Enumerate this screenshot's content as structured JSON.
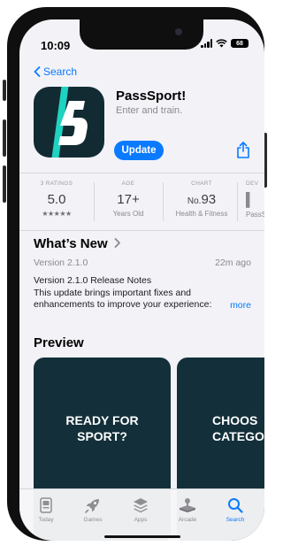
{
  "status_bar": {
    "time": "10:09",
    "battery": "68"
  },
  "nav": {
    "back_label": "Search"
  },
  "app": {
    "name": "PassSport!",
    "tagline": "Enter and train.",
    "update_label": "Update",
    "icon_glyph": "5"
  },
  "stats": [
    {
      "label": "3 RATINGS",
      "value": "5.0",
      "sub": "★★★★★"
    },
    {
      "label": "AGE",
      "value": "17+",
      "sub": "Years Old"
    },
    {
      "label": "CHART",
      "value_prefix": "No.",
      "value": "93",
      "sub": "Health & Fitness"
    },
    {
      "label": "DEV",
      "value": "",
      "sub": "PassS"
    }
  ],
  "whats_new": {
    "title": "What’s New",
    "version": "Version 2.1.0",
    "time_ago": "22m ago",
    "notes_line1": "Version 2.1.0 Release Notes",
    "notes_line2": "This update brings important fixes and",
    "notes_line3": "enhancements to improve your experience:",
    "more_label": "more"
  },
  "preview": {
    "title": "Preview",
    "shots": [
      {
        "line1": "READY FOR",
        "line2": "SPORT?"
      },
      {
        "line1": "CHOOS",
        "line2": "CATEGO"
      }
    ]
  },
  "tabbar": {
    "items": [
      {
        "label": "Today",
        "icon": "today-icon"
      },
      {
        "label": "Games",
        "icon": "rocket-icon"
      },
      {
        "label": "Apps",
        "icon": "stack-icon"
      },
      {
        "label": "Arcade",
        "icon": "joystick-icon"
      },
      {
        "label": "Search",
        "icon": "search-icon",
        "active": true
      }
    ]
  },
  "colors": {
    "accent": "#0a7aff",
    "app_icon_bg": "#122b33",
    "icon_stripe": "#1fd2c2"
  }
}
